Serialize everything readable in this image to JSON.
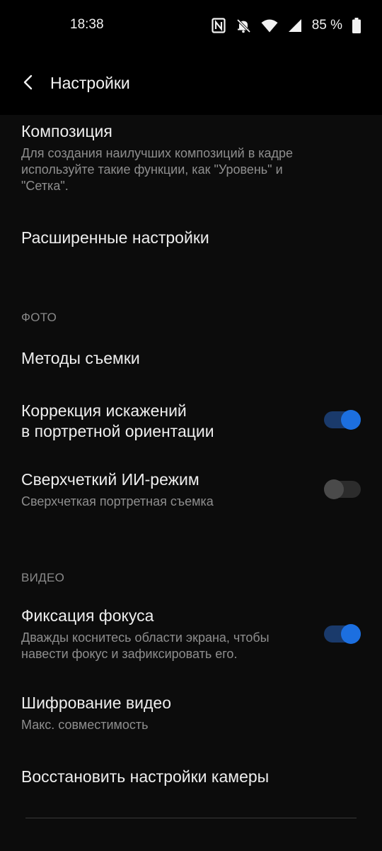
{
  "status": {
    "time": "18:38",
    "battery": "85 %",
    "icons": [
      "nfc-icon",
      "bell-off-icon",
      "wifi-icon",
      "signal-icon",
      "battery-icon"
    ]
  },
  "header": {
    "title": "Настройки",
    "back_icon": "back-arrow-icon"
  },
  "settings": {
    "composition": {
      "title": "Композиция",
      "subtitle": "Для создания наилучших композиций в кадре используйте такие функции, как \"Уровень\" и \"Сетка\"."
    },
    "advanced": {
      "title": "Расширенные настройки"
    },
    "photo_section": "ФОТО",
    "shooting_methods": {
      "title": "Методы съемки"
    },
    "distortion": {
      "title": "Коррекция искажений\nв портретной ориентации",
      "enabled": true
    },
    "ai_mode": {
      "title": "Сверхчеткий ИИ-режим",
      "subtitle": "Сверхчеткая портретная съемка",
      "enabled": false
    },
    "video_section": "ВИДЕО",
    "focus_lock": {
      "title": "Фиксация фокуса",
      "subtitle": "Дважды коснитесь области экрана, чтобы навести фокус и зафиксировать его.",
      "enabled": true
    },
    "video_encoding": {
      "title": "Шифрование видео",
      "subtitle": "Макс. совместимость"
    },
    "restore": {
      "title": "Восстановить настройки камеры"
    }
  },
  "colors": {
    "accent": "#1c6fe0",
    "background": "#0c0c0c"
  }
}
